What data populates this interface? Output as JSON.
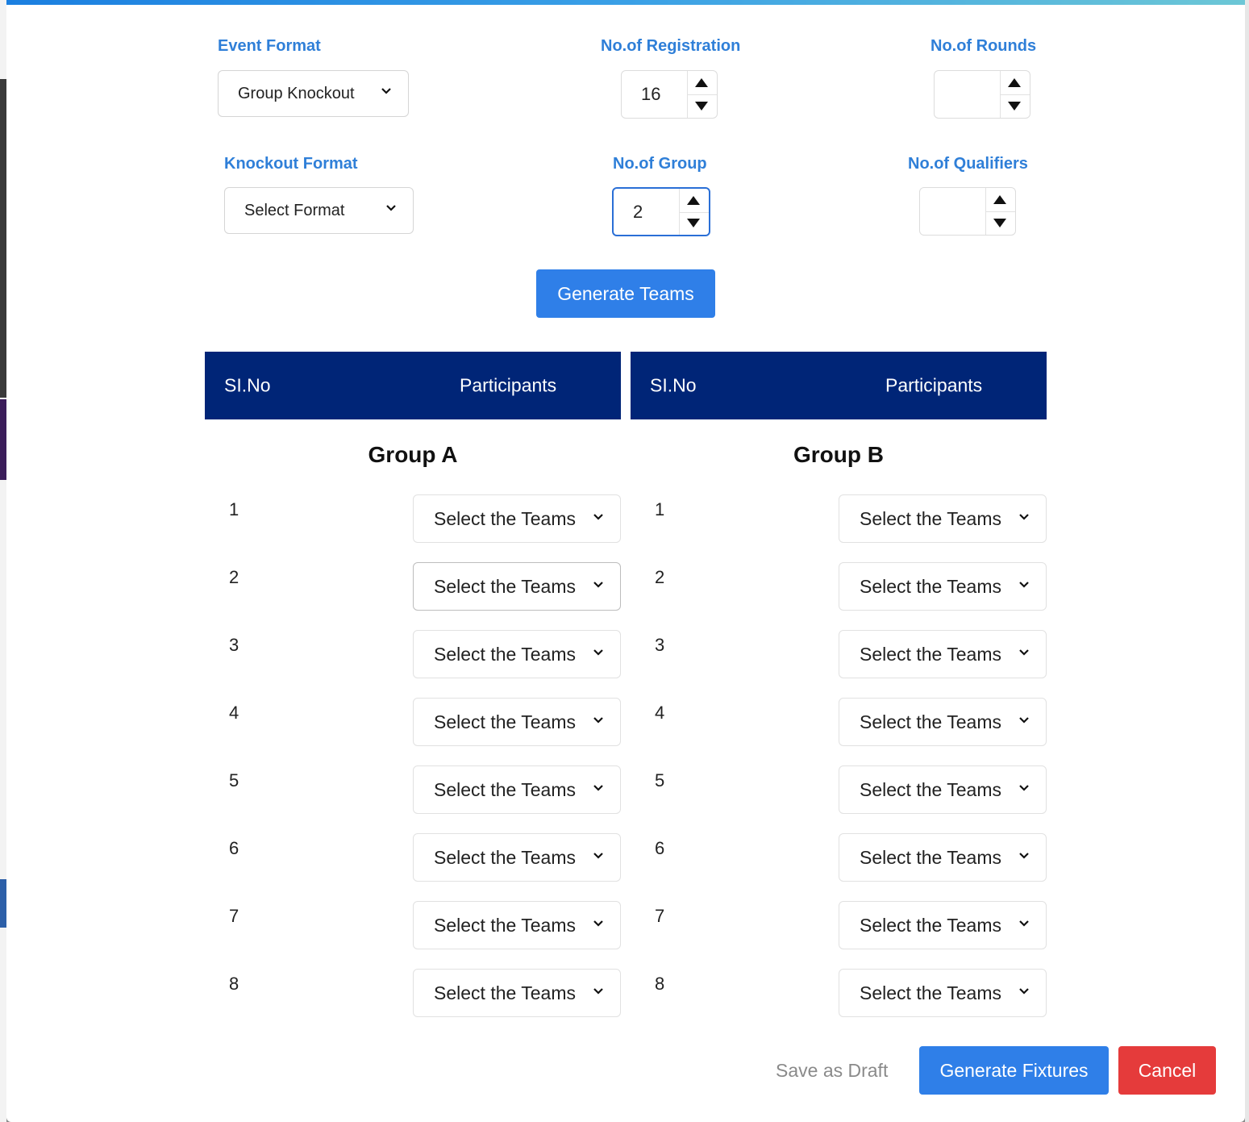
{
  "form": {
    "event_format": {
      "label": "Event Format",
      "value": "Group Knockout"
    },
    "registrations": {
      "label": "No.of Registration",
      "value": "16"
    },
    "rounds": {
      "label": "No.of Rounds",
      "value": ""
    },
    "knockout_format": {
      "label": "Knockout Format",
      "value": "Select Format"
    },
    "groups": {
      "label": "No.of Group",
      "value": "2"
    },
    "qualifiers": {
      "label": "No.of Qualifiers",
      "value": ""
    }
  },
  "generate_teams_label": "Generate Teams",
  "table": {
    "col_slno": "SI.No",
    "col_participants": "Participants"
  },
  "groups": [
    {
      "name": "Group A",
      "rows": [
        {
          "no": "1",
          "select": "Select the Teams"
        },
        {
          "no": "2",
          "select": "Select the Teams"
        },
        {
          "no": "3",
          "select": "Select the Teams"
        },
        {
          "no": "4",
          "select": "Select the Teams"
        },
        {
          "no": "5",
          "select": "Select the Teams"
        },
        {
          "no": "6",
          "select": "Select the Teams"
        },
        {
          "no": "7",
          "select": "Select the Teams"
        },
        {
          "no": "8",
          "select": "Select the Teams"
        }
      ]
    },
    {
      "name": "Group B",
      "rows": [
        {
          "no": "1",
          "select": "Select the Teams"
        },
        {
          "no": "2",
          "select": "Select the Teams"
        },
        {
          "no": "3",
          "select": "Select the Teams"
        },
        {
          "no": "4",
          "select": "Select the Teams"
        },
        {
          "no": "5",
          "select": "Select the Teams"
        },
        {
          "no": "6",
          "select": "Select the Teams"
        },
        {
          "no": "7",
          "select": "Select the Teams"
        },
        {
          "no": "8",
          "select": "Select the Teams"
        }
      ]
    }
  ],
  "footer": {
    "save_draft": "Save as Draft",
    "generate_fixtures": "Generate Fixtures",
    "cancel": "Cancel"
  },
  "colors": {
    "label_blue": "#2f7fd8",
    "table_header": "#002577",
    "primary_button": "#2f7fe8",
    "cancel_button": "#e53b3b"
  },
  "icons": {
    "dropdown": "chevron-down-icon",
    "spinner_up": "caret-up-icon",
    "spinner_down": "caret-down-icon"
  }
}
